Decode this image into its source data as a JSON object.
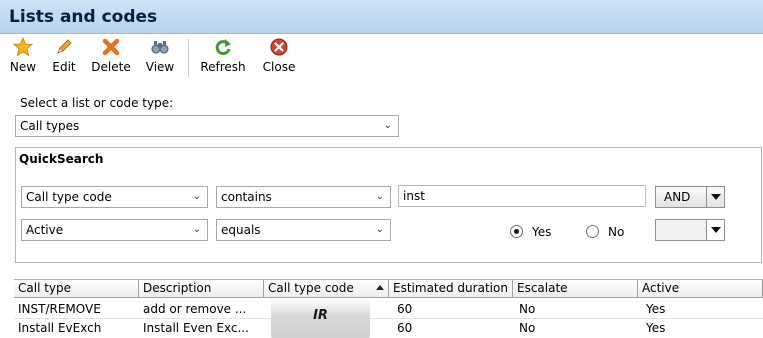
{
  "window": {
    "title": "Lists and codes"
  },
  "toolbar": {
    "new_label": "New",
    "edit_label": "Edit",
    "delete_label": "Delete",
    "view_label": "View",
    "refresh_label": "Refresh",
    "close_label": "Close"
  },
  "list_selector": {
    "label": "Select a list or code type:",
    "value": "Call types"
  },
  "quicksearch": {
    "title": "QuickSearch",
    "row1": {
      "field": "Call type code",
      "operator": "contains",
      "value": "inst",
      "logic": "AND"
    },
    "row2": {
      "field": "Active",
      "operator": "equals",
      "yes_label": "Yes",
      "no_label": "No",
      "selected": "Yes"
    }
  },
  "grid": {
    "columns": [
      "Call type",
      "Description",
      "Call type code",
      "Estimated duration",
      "Escalate",
      "Active"
    ],
    "sorted_column": "Call type code",
    "rows": [
      [
        "INST/REMOVE",
        "add or remove ...",
        "",
        "60",
        "No",
        "Yes"
      ],
      [
        "Install EvExch",
        "Install Even Exc...",
        "",
        "60",
        "No",
        "Yes"
      ]
    ]
  },
  "overlay": {
    "text": "IR"
  },
  "colors": {
    "titlebar": "#c4dbf2",
    "title_text": "#0d1f3c"
  }
}
